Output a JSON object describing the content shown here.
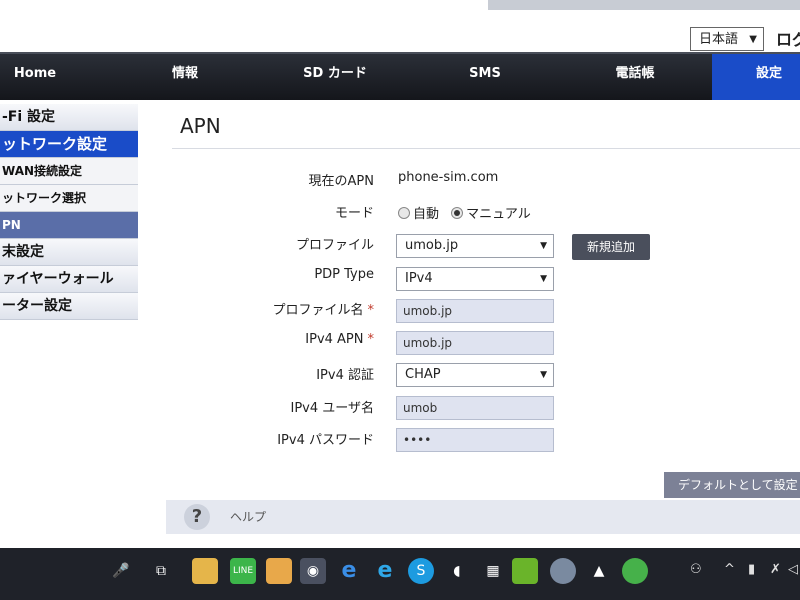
{
  "header": {
    "language_value": "日本語",
    "logout_label": "ログ"
  },
  "nav": {
    "items": [
      "Home",
      "情報",
      "SD カード",
      "SMS",
      "電話帳",
      "設定"
    ],
    "active_index": 5
  },
  "sidebar": {
    "items": [
      "-Fi 設定",
      "ットワーク設定",
      "WAN接続設定",
      "ットワーク選択",
      "PN",
      "末設定",
      "ァイヤーウォール",
      "ーター設定"
    ],
    "selected": "PN"
  },
  "page": {
    "title": "APN",
    "current_apn_label": "現在のAPN",
    "current_apn_value": "phone-sim.com",
    "mode_label": "モード",
    "mode_auto": "自動",
    "mode_manual": "マニュアル",
    "mode_selected": "マニュアル",
    "profile_label": "プロファイル",
    "profile_value": "umob.jp",
    "new_button": "新規追加",
    "pdp_label": "PDP Type",
    "pdp_value": "IPv4",
    "profile_name_label": "プロファイル名",
    "profile_name_value": "umob.jp",
    "ipv4_apn_label": "IPv4 APN",
    "ipv4_apn_value": "umob.jp",
    "ipv4_auth_label": "IPv4 認証",
    "ipv4_auth_value": "CHAP",
    "ipv4_user_label": "IPv4 ユーザ名",
    "ipv4_user_value": "umob",
    "ipv4_pass_label": "IPv4 パスワード",
    "ipv4_pass_value": "••••",
    "required_mark": "*",
    "default_button": "デフォルトとして設定",
    "help_label": "ヘルプ",
    "help_icon": "?"
  },
  "taskbar": {
    "icons": [
      "microphone-icon",
      "task-view-icon",
      "file-explorer-icon",
      "line-icon",
      "photo-app-icon",
      "chrome-icon",
      "edge-icon",
      "ie-icon",
      "skype-icon",
      "app-icon",
      "calculator-icon",
      "app-green-icon",
      "app-circle-icon",
      "app-onigiri-icon",
      "wechat-icon"
    ],
    "tray": [
      "people-icon",
      "chevron-up-icon",
      "network-icon",
      "pin-icon",
      "volume-icon"
    ]
  },
  "colors": {
    "nav_bg": "#1b1d23",
    "active_blue": "#1a4cc8",
    "input_bg": "#dfe3f0",
    "taskbar_bg": "#1f2229"
  }
}
